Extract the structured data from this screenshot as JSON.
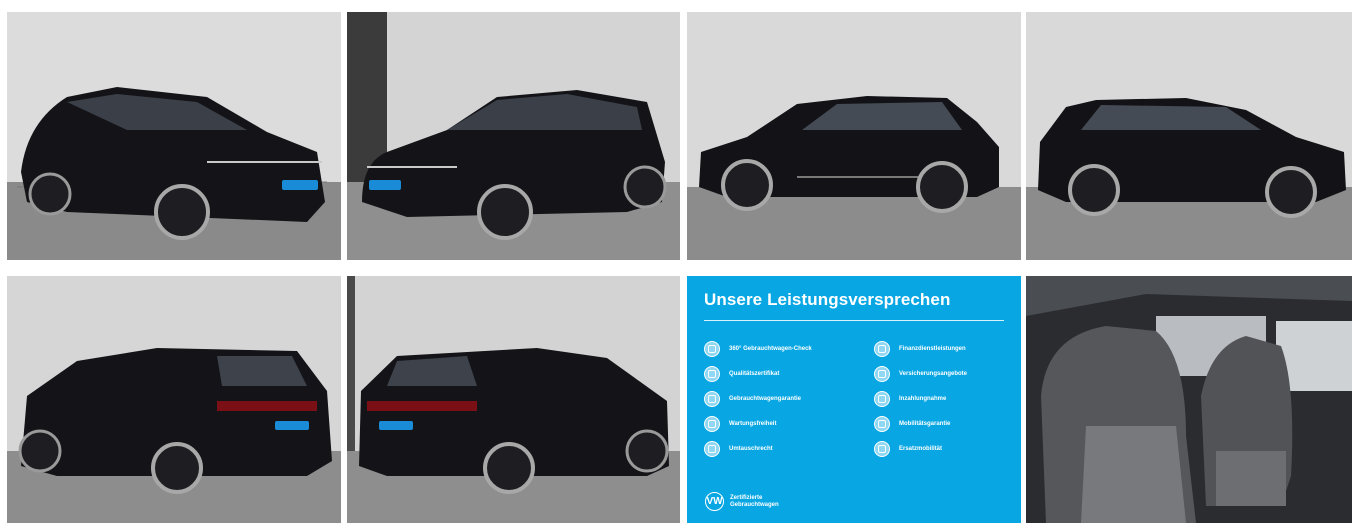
{
  "gallery": {
    "photos": [
      {
        "label": "SUV front three-quarter left view"
      },
      {
        "label": "SUV front three-quarter right view"
      },
      {
        "label": "SUV side left view"
      },
      {
        "label": "SUV side right view"
      },
      {
        "label": "SUV rear three-quarter left view"
      },
      {
        "label": "SUV rear three-quarter right view"
      },
      {
        "label": "Interior front seats view"
      }
    ]
  },
  "promise_panel": {
    "title": "Unsere Leistungsversprechen",
    "left_items": [
      {
        "label": "360° Gebrauchtwagen-Check",
        "icon": "check-icon"
      },
      {
        "label": "Qualitätszertifikat",
        "icon": "certificate-icon"
      },
      {
        "label": "Gebrauchtwagengarantie",
        "icon": "shield-icon"
      },
      {
        "label": "Wartungsfreiheit",
        "icon": "wrench-icon"
      },
      {
        "label": "Umtauschrecht",
        "icon": "exchange-icon"
      }
    ],
    "right_items": [
      {
        "label": "Finanzdienstleistungen",
        "icon": "finance-icon"
      },
      {
        "label": "Versicherungsangebote",
        "icon": "insurance-icon"
      },
      {
        "label": "Inzahlungnahme",
        "icon": "trade-in-icon"
      },
      {
        "label": "Mobilitätsgarantie",
        "icon": "car-icon"
      },
      {
        "label": "Ersatzmobilität",
        "icon": "replacement-car-icon"
      }
    ],
    "badge_line1": "Zertifizierte",
    "badge_line2": "Gebrauchtwagen",
    "badge_logo": "VW",
    "background_color": "#08a7e4"
  }
}
